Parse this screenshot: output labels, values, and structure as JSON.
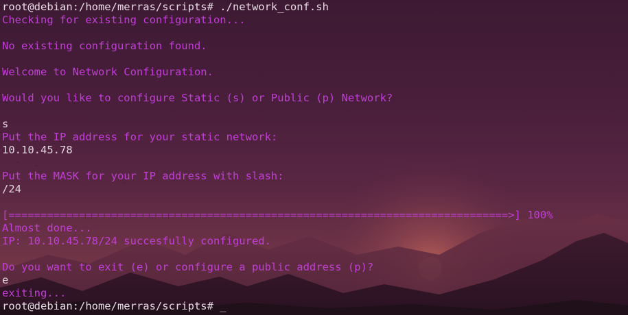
{
  "terminal": {
    "lines": [
      {
        "text": "root@debian:/home/merras/scripts# ./network_conf.sh",
        "kind": "prompt"
      },
      {
        "text": "Checking for existing configuration...",
        "kind": "output"
      },
      {
        "text": "",
        "kind": "blank"
      },
      {
        "text": "No existing configuration found.",
        "kind": "output"
      },
      {
        "text": "",
        "kind": "blank"
      },
      {
        "text": "Welcome to Network Configuration.",
        "kind": "output"
      },
      {
        "text": "",
        "kind": "blank"
      },
      {
        "text": "Would you like to configure Static (s) or Public (p) Network?",
        "kind": "output"
      },
      {
        "text": "",
        "kind": "blank"
      },
      {
        "text": "s",
        "kind": "user-input"
      },
      {
        "text": "Put the IP address for your static network:",
        "kind": "output"
      },
      {
        "text": "10.10.45.78",
        "kind": "user-input"
      },
      {
        "text": "",
        "kind": "blank"
      },
      {
        "text": "Put the MASK for your IP address with slash:",
        "kind": "output"
      },
      {
        "text": "/24",
        "kind": "user-input"
      },
      {
        "text": "",
        "kind": "blank"
      },
      {
        "text": "[==============================================================================>] 100%",
        "kind": "output"
      },
      {
        "text": "Almost done...",
        "kind": "output"
      },
      {
        "text": "IP: 10.10.45.78/24 succesfully configured.",
        "kind": "output"
      },
      {
        "text": "",
        "kind": "blank"
      },
      {
        "text": "Do you want to exit (e) or configure a public address (p)?",
        "kind": "output"
      },
      {
        "text": "e",
        "kind": "user-input"
      },
      {
        "text": "exiting...",
        "kind": "output"
      },
      {
        "text": "root@debian:/home/merras/scripts# ",
        "kind": "prompt"
      }
    ],
    "cursor": "_",
    "colors": {
      "output": "#c13fd6",
      "prompt": "#e9dce6",
      "user_input": "#e4d6e1"
    }
  }
}
